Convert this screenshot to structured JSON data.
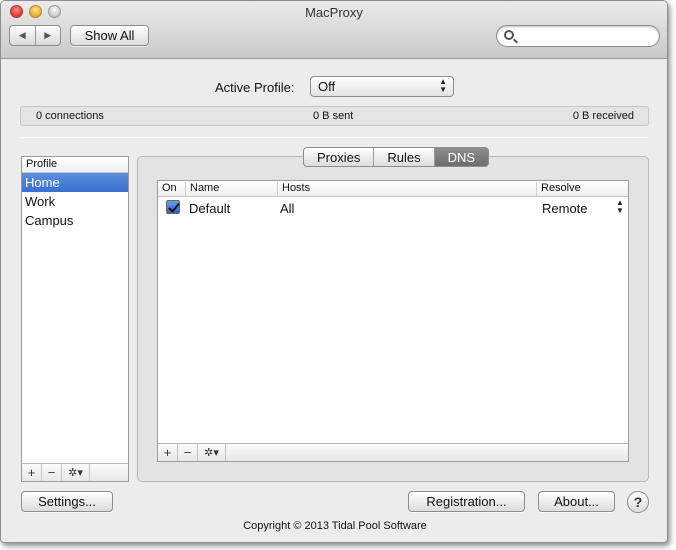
{
  "window": {
    "title": "MacProxy"
  },
  "toolbar": {
    "back_icon": "◀",
    "forward_icon": "▶",
    "show_all_label": "Show All",
    "search_placeholder": ""
  },
  "active_profile": {
    "label": "Active Profile:",
    "value": "Off"
  },
  "stats": {
    "connections": "0 connections",
    "sent": "0 B sent",
    "received": "0 B received"
  },
  "profiles": {
    "header": "Profile",
    "items": [
      {
        "label": "Home",
        "selected": true
      },
      {
        "label": "Work",
        "selected": false
      },
      {
        "label": "Campus",
        "selected": false
      }
    ],
    "add_label": "+",
    "remove_label": "−",
    "action_label": "✲▾"
  },
  "tabs": [
    {
      "label": "Proxies",
      "active": false
    },
    {
      "label": "Rules",
      "active": false
    },
    {
      "label": "DNS",
      "active": true
    }
  ],
  "dns_table": {
    "headers": {
      "on": "On",
      "name": "Name",
      "hosts": "Hosts",
      "resolve": "Resolve"
    },
    "rows": [
      {
        "checked": true,
        "name": "Default",
        "hosts": "All",
        "resolve": "Remote"
      }
    ],
    "add_label": "+",
    "remove_label": "−",
    "action_label": "✲▾"
  },
  "buttons": {
    "settings": "Settings...",
    "registration": "Registration...",
    "about": "About...",
    "help": "?"
  },
  "footer": {
    "copyright": "Copyright © 2013 Tidal Pool Software"
  },
  "colors": {
    "selection": "#3a6fd0",
    "active_tab": "#7a7a7a"
  }
}
